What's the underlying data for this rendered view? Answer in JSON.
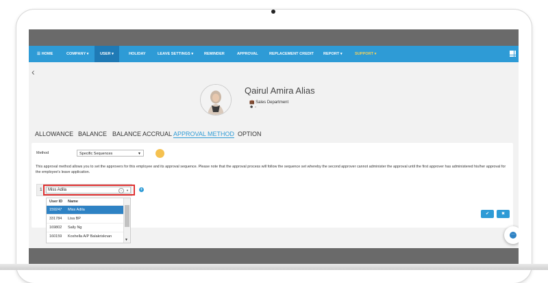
{
  "nav": {
    "items": [
      {
        "label": "☰ HOME"
      },
      {
        "label": "COMPANY ▾"
      },
      {
        "label": "USER ▾"
      },
      {
        "label": "HOLIDAY"
      },
      {
        "label": "LEAVE SETTINGS ▾"
      },
      {
        "label": "REMINDER"
      },
      {
        "label": "APPROVAL"
      },
      {
        "label": "REPLACEMENT CREDIT"
      },
      {
        "label": "REPORT ▾"
      },
      {
        "label": "SUPPORT ▾"
      }
    ],
    "active_index": 2,
    "accent": "#2e9bd6",
    "support_color": "#f6d35a"
  },
  "profile": {
    "name": "Qairul Amira Alias",
    "department": "Sales Department",
    "extra": "-"
  },
  "tabs": [
    "ALLOWANCE",
    "BALANCE",
    "BALANCE ACCRUAL",
    "APPROVAL METHOD",
    "OPTION"
  ],
  "active_tab": "APPROVAL METHOD",
  "form": {
    "method_label": "Method",
    "method_value": "Specific Sequences",
    "description": "This approval method allows you to set the approvers for this employee and its approval sequence. Please note that the approval process will follow the sequence set whereby the second approver cannot administer the approval until the first approver has administered his/her approval for the employee's leave application.",
    "row_number": "1",
    "search_value": "Miss Adila"
  },
  "dropdown": {
    "headers": {
      "user_id": "User ID",
      "name": "Name"
    },
    "rows": [
      {
        "id": "159247",
        "name": "Miss Adila"
      },
      {
        "id": "331784",
        "name": "Lisa BP"
      },
      {
        "id": "169802",
        "name": "Sally Ng"
      },
      {
        "id": "160159",
        "name": "Koshella A/P Balakrisknan"
      }
    ],
    "selected_index": 0
  },
  "buttons": {
    "confirm": "✔",
    "cancel": "✖"
  },
  "icons": [
    "menu-grid-icon",
    "back-arrow-icon",
    "briefcase-icon",
    "user-circle-icon",
    "bulb-icon",
    "add-circle-icon",
    "clear-icon",
    "chat-icon"
  ]
}
